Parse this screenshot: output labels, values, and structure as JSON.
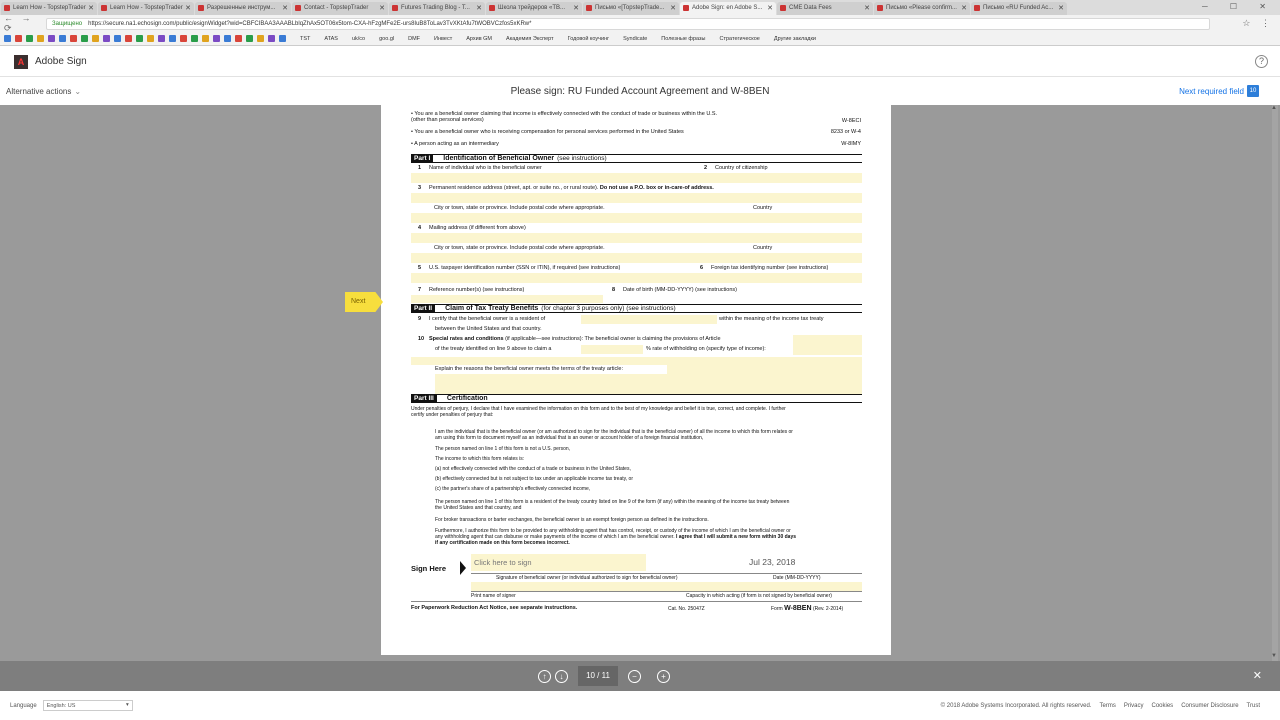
{
  "browser": {
    "tabs": [
      {
        "label": "Learn How - TopstepTrader",
        "active": false
      },
      {
        "label": "Learn How - TopstepTrader",
        "active": false
      },
      {
        "label": "Разрешенные инструм...",
        "active": false
      },
      {
        "label": "Contact - TopstepTrader",
        "active": false
      },
      {
        "label": "Futures Trading Blog - T...",
        "active": false
      },
      {
        "label": "Школа трейдеров «ТВ...",
        "active": false
      },
      {
        "label": "Письмо «[TopstepTrade...",
        "active": false
      },
      {
        "label": "Adobe Sign: en Adobe S...",
        "active": true
      },
      {
        "label": "CME Data Fees",
        "active": false
      },
      {
        "label": "Письмо «Please confirm...",
        "active": false
      },
      {
        "label": "Письмо «RU Funded Ac...",
        "active": false
      }
    ],
    "secure_label": "Защищено",
    "url": "https://secure.na1.echosign.com/public/esignWidget?wid=CBFCIBAA3AAABLblqZhAx5OT06x5tom-CXA-hFzgMFe2E-urs8IuB8ToLav3TvXKtAfu7tWOBVCzfos5xKRw*",
    "bookmarks": [
      "TST",
      "ATAS",
      "uk/co",
      "goo.gl",
      "DMF",
      "Инвест",
      "Архив GM",
      "Академия Эксперт",
      "Годовой коучинг",
      "Syndicate",
      "Полезные фразы",
      "Стратегическое",
      "Другие закладки"
    ]
  },
  "header": {
    "brand": "Adobe Sign",
    "help_label": "?"
  },
  "subbar": {
    "alternative_actions": "Alternative actions",
    "title": "Please sign: RU Funded Account Agreement and W-8BEN",
    "next_required": "Next required field",
    "remaining_count": "10"
  },
  "form": {
    "top_lines": [
      {
        "text": "• You are a beneficial owner claiming that income is effectively connected with the conduct of trade or business within the U.S.",
        "right": "W-8ECI"
      },
      {
        "text": "   (other than personal services)",
        "right": ""
      },
      {
        "text": "• You are a beneficial owner who is receiving compensation for personal services performed in the United States",
        "right": "8233 or W-4"
      },
      {
        "text": "• A person acting as an intermediary",
        "right": "W-8IMY"
      }
    ],
    "part1": {
      "tag": "Part I",
      "title": "Identification of Beneficial Owner",
      "sub": "(see instructions)",
      "l1": "Name of individual who is the beneficial owner",
      "l2": "Country of citizenship",
      "l3": "Permanent residence address (street, apt. or suite no., or rural route).",
      "l3b": "Do not use a P.O. box or in-care-of address.",
      "city": "City or town, state or province. Include postal code where appropriate.",
      "country": "Country",
      "l4": "Mailing address (if different from above)",
      "l5": "U.S. taxpayer identification number (SSN or ITIN), if required (see instructions)",
      "l6": "Foreign tax identifying number (see instructions)",
      "l7": "Reference number(s) (see instructions)",
      "l8": "Date of birth (MM-DD-YYYY) (see instructions)"
    },
    "part2": {
      "tag": "Part II",
      "title": "Claim of Tax Treaty Benefits",
      "sub": "(for chapter 3 purposes only) (see instructions)",
      "l9a": "I certify that the beneficial owner is a resident of",
      "l9b": "within the meaning of the income tax treaty",
      "l9c": "between the United States and that country.",
      "l10a_b": "Special rates and conditions",
      "l10a": "(if applicable—see instructions): The beneficial owner is claiming the provisions of Article",
      "l10b": "of the treaty identified on line 9 above to claim a",
      "l10c": "% rate of withholding on (specify type of income):",
      "l10d": "Explain the reasons the beneficial owner meets the terms of the treaty article:"
    },
    "part3": {
      "tag": "Part III",
      "title": "Certification",
      "intro1": "Under penalties of perjury, I declare that I have examined the information on this form and to the best of my knowledge and belief it is true, correct, and complete. I further",
      "intro2": "certify under penalties of perjury that:",
      "b1a": "I am the individual that is the beneficial owner (or am authorized to sign for the individual that is the beneficial owner) of all the income to which this form relates or",
      "b1b": "am using this form to document myself as an individual that is an owner or account holder of a foreign financial institution,",
      "b2": "The person named on line 1 of this form is not a U.S. person,",
      "b3": "The income to which this form relates is:",
      "b3a": "(a) not effectively connected with the conduct of a trade or business in the United States,",
      "b3b": "(b) effectively connected but is not subject to tax under an applicable income tax treaty, or",
      "b3c": "(c) the partner's share of a partnership's effectively connected income,",
      "b4a": "The person named on line 1 of this form is a resident of the treaty country listed on line 9 of the form (if any) within the meaning of the income tax treaty between",
      "b4b": "the United States and that country, and",
      "b5": "For broker transactions or barter exchanges, the beneficial owner is an exempt foreign person as defined in the instructions.",
      "f1": "Furthermore, I authorize this form to be provided to any withholding agent that has control, receipt, or custody of the income of which I am the beneficial owner or",
      "f2": "any withholding agent that can disburse or make payments of the income of which I am the beneficial owner.",
      "f2b": "I agree that I will submit a new form within 30 days",
      "f3": "if any certification made on this form becomes incorrect."
    },
    "sign": {
      "sign_here": "Sign Here",
      "click_to_sign": "Click here to sign",
      "date_value": "Jul 23, 2018",
      "sig_caption": "Signature of beneficial owner (or individual authorized to sign for beneficial owner)",
      "date_caption": "Date (MM-DD-YYYY)",
      "print_name": "Print name of signer",
      "capacity": "Capacity in which acting (if form is not signed by beneficial owner)"
    },
    "footer": {
      "paperwork": "For Paperwork Reduction Act Notice, see separate instructions.",
      "cat": "Cat. No. 25047Z",
      "form_label": "Form",
      "form_name": "W-8BEN",
      "rev": "(Rev. 2-2014)"
    },
    "num_labels": [
      "1",
      "2",
      "3",
      "4",
      "5",
      "6",
      "7",
      "8",
      "9",
      "10"
    ]
  },
  "next_tag": "Next",
  "pager": {
    "page_display": "10 / 11"
  },
  "footer": {
    "language_label": "Language",
    "language_value": "English: US",
    "copyright": "© 2018 Adobe Systems Incorporated. All rights reserved.",
    "links": [
      "Terms",
      "Privacy",
      "Cookies",
      "Consumer Disclosure",
      "Trust"
    ]
  }
}
